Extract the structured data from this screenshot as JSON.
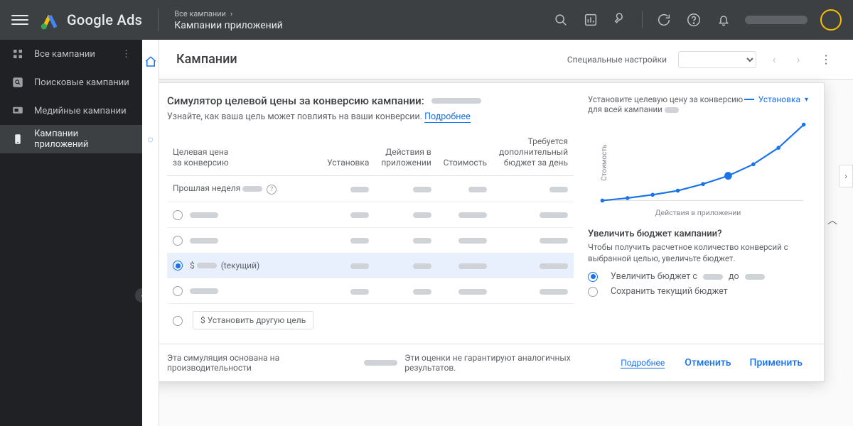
{
  "brand": "Google Ads",
  "breadcrumb": {
    "all": "Все кампании",
    "current": "Кампании приложений"
  },
  "sidebar": {
    "items": [
      {
        "label": "Все кампании"
      },
      {
        "label": "Поисковые кампании"
      },
      {
        "label": "Медийные кампании"
      },
      {
        "label": "Кампании приложений"
      }
    ]
  },
  "page": {
    "title": "Кампании",
    "special": "Специальные настройки"
  },
  "sim": {
    "title": "Симулятор целевой цены за конверсию кампании:",
    "sub": "Узнайте, как ваша цель может повлиять на ваши конверсии.",
    "more": "Подробнее",
    "cols": {
      "c1a": "Целевая цена",
      "c1b": "за конверсию",
      "c2": "Установка",
      "c3a": "Действия в",
      "c3b": "приложении",
      "c4": "Стоимость",
      "c5a": "Требуется",
      "c5b": "дополнительный",
      "c5c": "бюджет за день"
    },
    "past": "Прошлая неделя",
    "current_suffix": "(tекущий)",
    "set_other": "Установить другую цель",
    "dollar": "$"
  },
  "right": {
    "title": "Установите целевую цену за конверсию для всей кампании",
    "legend": "Установка",
    "ylab": "Стоимость",
    "xlab": "Действия в приложении",
    "q": "Увеличить бюджет кампании?",
    "help": "Чтобы получить расчетное количество конверсий с выбранной целью, увеличьте бюджет.",
    "opt1a": "Увеличить бюджет с",
    "opt1b": "до",
    "opt2": "Сохранить текущий бюджет"
  },
  "chart_data": {
    "type": "line",
    "x": [
      0,
      1,
      2,
      3,
      4,
      5,
      6,
      7,
      8
    ],
    "values": [
      100,
      97,
      93,
      88,
      80,
      70,
      56,
      36,
      8
    ],
    "selected_index": 5,
    "xlabel": "Действия в приложении",
    "ylabel": "Стоимость"
  },
  "footer": {
    "t1": "Эта симуляция основана на производительности",
    "t2": "Эти оценки не гарантируют аналогичных результатов.",
    "more": "Подробнее",
    "cancel": "Отменить",
    "apply": "Применить"
  }
}
